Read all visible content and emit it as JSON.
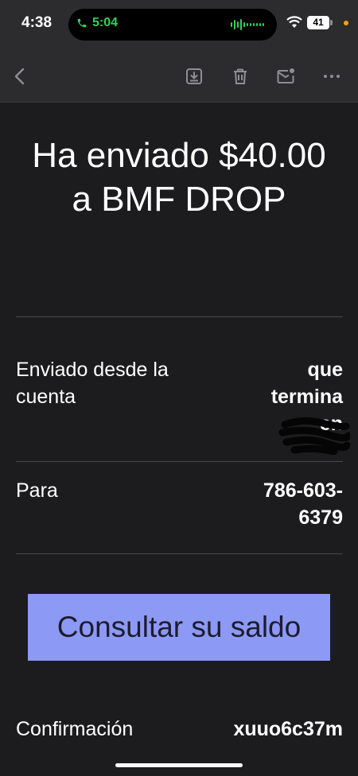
{
  "status_bar": {
    "time": "4:38",
    "call_time": "5:04",
    "battery": "41"
  },
  "toolbar": {
    "icons": [
      "back-icon",
      "archive-icon",
      "trash-icon",
      "mark-unread-icon",
      "more-icon"
    ]
  },
  "email": {
    "headline": "Ha enviado $40.00 a BMF DROP",
    "rows": [
      {
        "label": "Enviado desde la cuenta",
        "value": "que termina en"
      },
      {
        "label": "Para",
        "value": "786-603-6379"
      }
    ],
    "cta_label": "Consultar su saldo",
    "confirmation": {
      "label": "Confirmación",
      "value": "xuuo6c37m"
    }
  },
  "colors": {
    "background": "#1c1c1e",
    "toolbar": "#2c2c2e",
    "cta": "#8c99f5",
    "call_green": "#30d158"
  }
}
